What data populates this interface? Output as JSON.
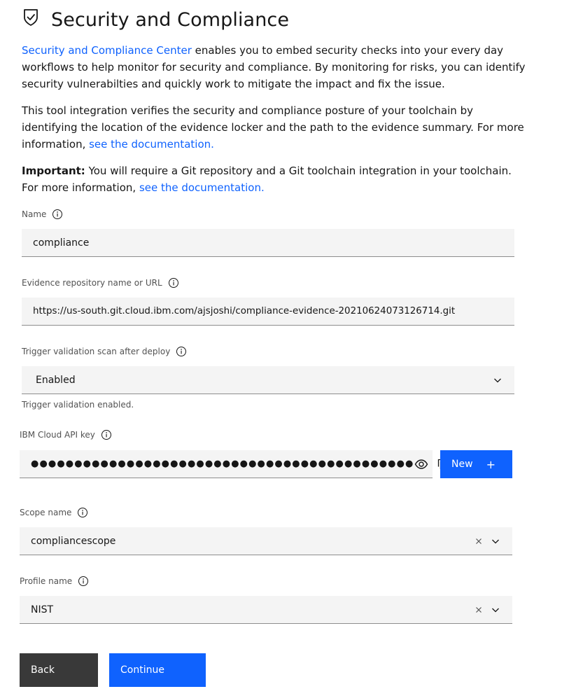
{
  "header": {
    "title": "Security and Compliance",
    "icon": "shield-check-icon"
  },
  "intro": {
    "link_text": "Security and Compliance Center",
    "text": " enables you to embed security checks into your every day workflows to help monitor for security and compliance. By monitoring for risks, you can identify security vulnerabilties and quickly work to mitigate the impact and fix the issue."
  },
  "integration": {
    "text": "This tool integration verifies the security and compliance posture of your toolchain by identifying the location of the evidence locker and the path to the evidence summary. For more information, ",
    "link_text": "see the documentation."
  },
  "important": {
    "bold": "Important:",
    "text": " You will require a Git repository and a Git toolchain integration in your toolchain. For more information, ",
    "link_text": "see the documentation."
  },
  "form": {
    "name": {
      "label": "Name",
      "value": "compliance"
    },
    "evidence_repo": {
      "label": "Evidence repository name or URL",
      "value": "https://us-south.git.cloud.ibm.com/ajsjoshi/compliance-evidence-20210624073126714.git"
    },
    "trigger_scan": {
      "label": "Trigger validation scan after deploy",
      "value": "Enabled",
      "helper": "Trigger validation enabled."
    },
    "api_key": {
      "label": "IBM Cloud API key",
      "masked": "●●●●●●●●●●●●●●●●●●●●●●●●●●●●●●●●●●●●●●●●●●●●",
      "new_label": "New",
      "new_icon": "+"
    },
    "scope": {
      "label": "Scope name",
      "value": "compliancescope"
    },
    "profile": {
      "label": "Profile name",
      "value": "NIST"
    }
  },
  "actions": {
    "back": "Back",
    "continue": "Continue"
  },
  "colors": {
    "primary": "#0f62fe",
    "secondary": "#393939",
    "field_bg": "#f4f4f4",
    "link": "#0f62fe"
  }
}
